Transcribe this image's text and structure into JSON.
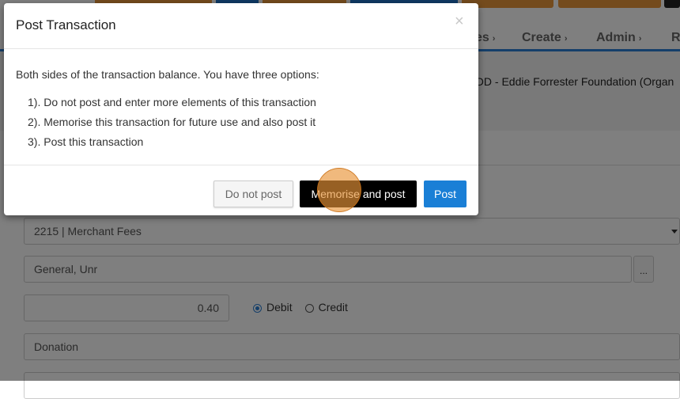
{
  "nav": {
    "items": [
      {
        "label": "es",
        "chevron": "›"
      },
      {
        "label": "Create",
        "chevron": "›"
      },
      {
        "label": "Admin",
        "chevron": "›"
      },
      {
        "label": "R",
        "chevron": ""
      }
    ]
  },
  "entity_header": {
    "text": ", DD - Eddie Forrester Foundation (Organ"
  },
  "form": {
    "account_select": "2215 | Merchant Fees",
    "fund_field": "General, Unr",
    "fund_lookup_button": "...",
    "amount": "0.40",
    "debit_label": "Debit",
    "credit_label": "Credit",
    "debit_selected": true,
    "memo_field": "Donation"
  },
  "modal": {
    "title": "Post Transaction",
    "close_icon": "×",
    "intro": "Both sides of the transaction balance. You have three options:",
    "options": [
      "1). Do not post and enter more elements of this transaction",
      "2). Memorise this transaction for future use and also post it",
      "3). Post this transaction"
    ],
    "buttons": {
      "do_not_post": "Do not post",
      "memorise_and_post": "Memorise and post",
      "post": "Post"
    }
  },
  "colors": {
    "primary": "#1a7fd6",
    "nav_accent": "#2a7fd4",
    "toolbar_orange": "#e8973a",
    "toolbar_blue": "#1f73c9",
    "click_marker": "#e8943a"
  }
}
